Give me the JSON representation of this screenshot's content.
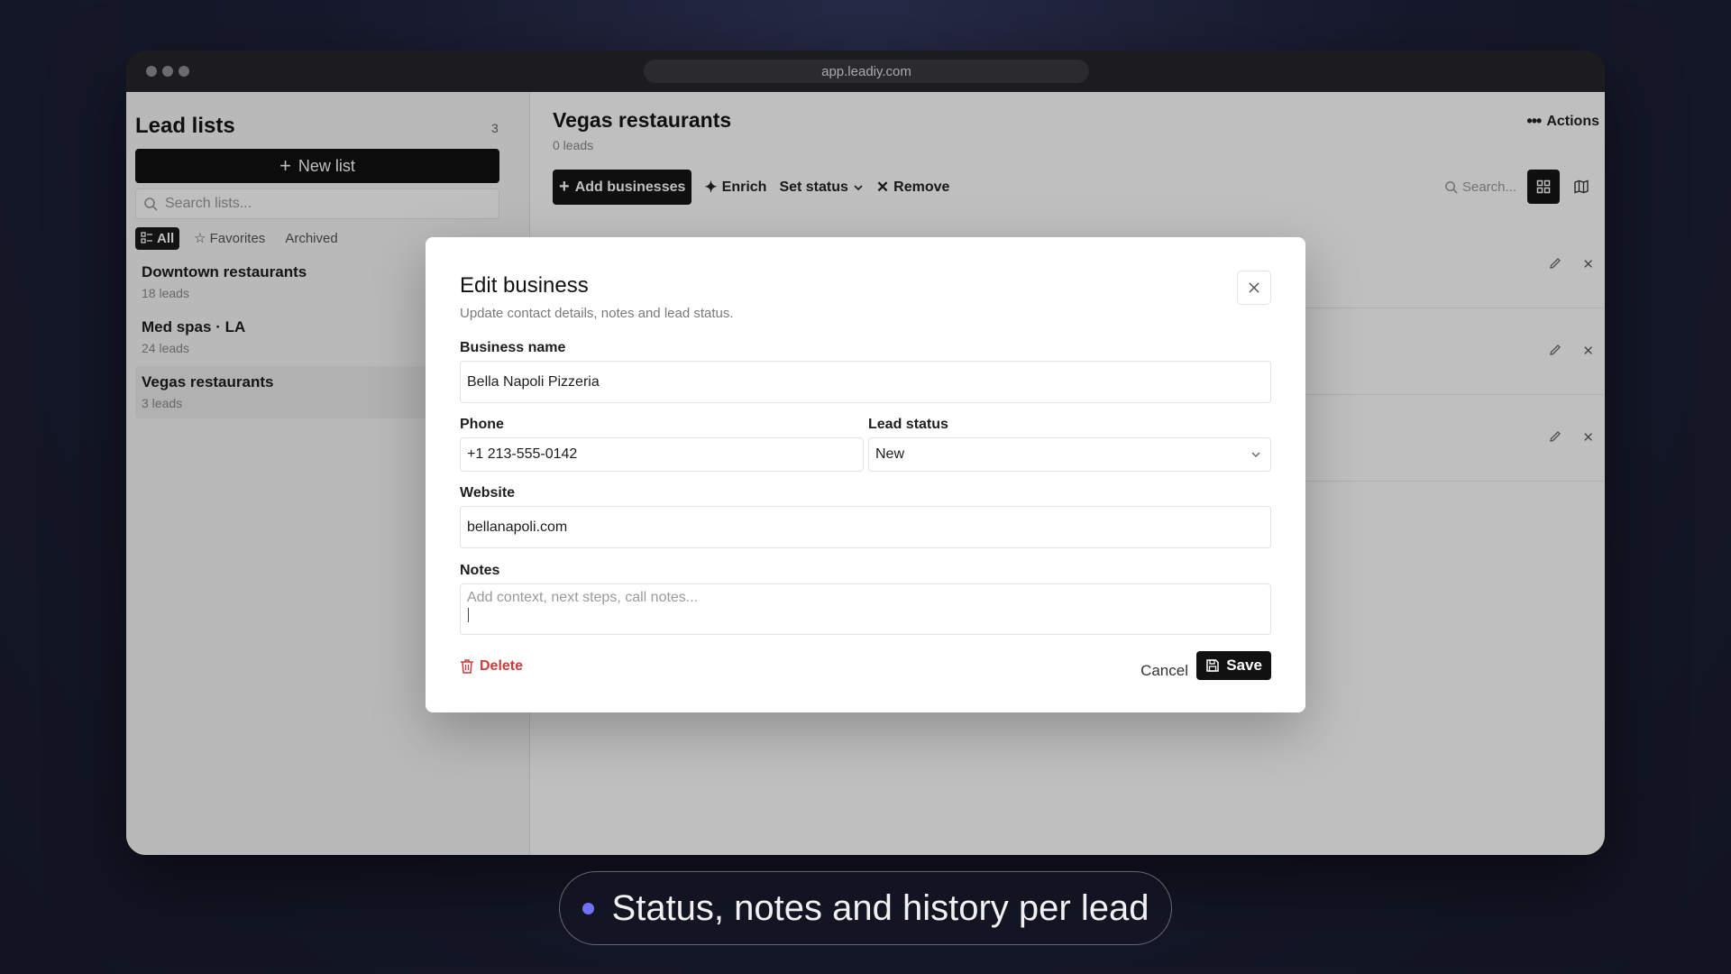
{
  "browser": {
    "url": "app.leadiy.com"
  },
  "sidebar": {
    "title": "Lead lists",
    "count": "3",
    "new_list_label": "New list",
    "search_placeholder": "Search lists...",
    "filters": [
      "All",
      "Favorites",
      "Archived"
    ],
    "active_filter": "All",
    "lists": [
      {
        "name": "Downtown restaurants",
        "count": "18 leads"
      },
      {
        "name": "Med spas · LA",
        "count": "24 leads"
      },
      {
        "name": "Vegas restaurants",
        "count": "3 leads"
      }
    ],
    "selected_list": "Vegas restaurants"
  },
  "main": {
    "title": "Vegas restaurants",
    "subtitle": "0 leads",
    "actions_label": "Actions",
    "toolbar": {
      "add_label": "Add businesses",
      "enrich_label": "Enrich",
      "set_status_label": "Set status",
      "remove_label": "Remove"
    },
    "search_placeholder": "Search..."
  },
  "modal": {
    "title": "Edit business",
    "subtitle": "Update contact details, notes and lead status.",
    "business_name_label": "Business name",
    "business_name_value": "Bella Napoli Pizzeria",
    "phone_label": "Phone",
    "phone_value": "+1 213-555-0142",
    "lead_status_label": "Lead status",
    "lead_status_value": "New",
    "website_label": "Website",
    "website_value": "bellanapoli.com",
    "notes_label": "Notes",
    "notes_placeholder": "Add context, next steps, call notes...",
    "delete_label": "Delete",
    "cancel_label": "Cancel",
    "save_label": "Save"
  },
  "caption": {
    "text": "Status, notes and history per lead"
  },
  "colors": {
    "accent_dot": "#6f72ff",
    "danger": "#d13a3a",
    "primary_button": "#111111"
  }
}
